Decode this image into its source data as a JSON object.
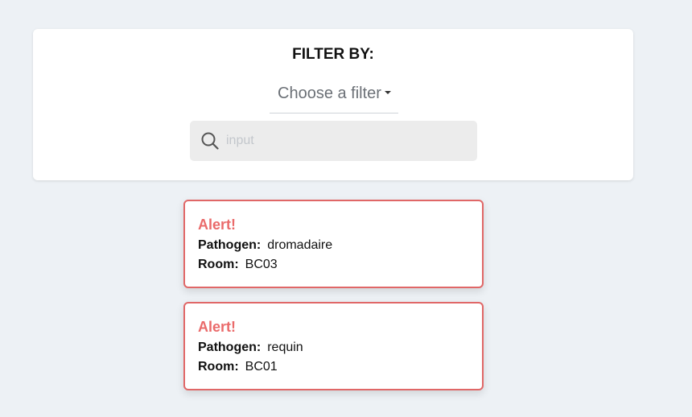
{
  "filter": {
    "title": "FILTER BY:",
    "select_label": "Choose a filter",
    "search_placeholder": "input",
    "search_value": ""
  },
  "alerts": [
    {
      "title": "Alert!",
      "pathogen_key": "Pathogen:",
      "pathogen_value": "dromadaire",
      "room_key": "Room:",
      "room_value": "BC03"
    },
    {
      "title": "Alert!",
      "pathogen_key": "Pathogen:",
      "pathogen_value": "requin",
      "room_key": "Room:",
      "room_value": "BC01"
    }
  ],
  "colors": {
    "background": "#edf1f5",
    "alert_accent": "#e06767",
    "alert_title": "#ea6a6a"
  },
  "icons": {
    "search": "search-icon",
    "dropdown": "caret-down-icon"
  }
}
